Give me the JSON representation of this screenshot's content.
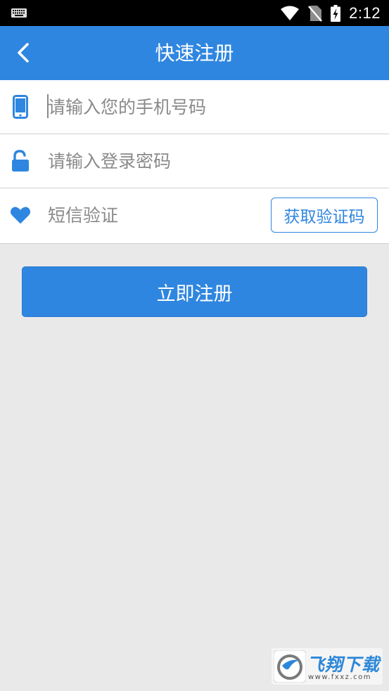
{
  "status_bar": {
    "time": "2:12",
    "icons": [
      "keyboard-icon",
      "wifi-icon",
      "no-sim-icon",
      "battery-charging-icon"
    ]
  },
  "app_bar": {
    "title": "快速注册",
    "back_icon": "chevron-left-icon"
  },
  "form": {
    "phone": {
      "icon": "phone-icon",
      "placeholder": "请输入您的手机号码",
      "value": ""
    },
    "password": {
      "icon": "unlock-icon",
      "placeholder": "请输入登录密码",
      "value": ""
    },
    "sms": {
      "icon": "heart-icon",
      "placeholder": "短信验证",
      "value": "",
      "get_code_label": "获取验证码"
    }
  },
  "register_button_label": "立即注册",
  "colors": {
    "primary": "#2f86e0",
    "background": "#e9e9e9",
    "placeholder": "#8a8a8a"
  },
  "watermark": {
    "text": "飞翔下载",
    "url": "www.fxxz.com"
  }
}
